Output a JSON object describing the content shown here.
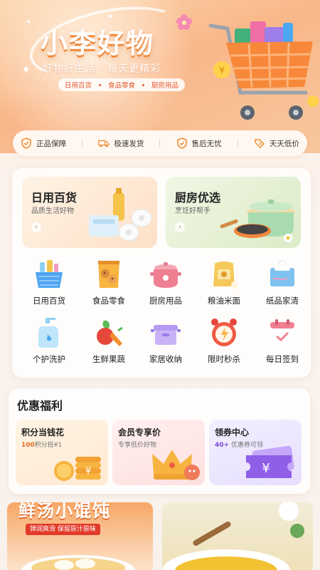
{
  "hero": {
    "brand": "小李好物",
    "slogan": "好物好生活 · 每天更精彩",
    "tags": [
      "日用百货",
      "食品零食",
      "厨房用品"
    ]
  },
  "guarantees": [
    {
      "icon": "shield-check-icon",
      "label": "正品保障"
    },
    {
      "icon": "truck-icon",
      "label": "极速发货"
    },
    {
      "icon": "service-shield-icon",
      "label": "售后无忧"
    },
    {
      "icon": "price-tag-icon",
      "label": "天天低价"
    }
  ],
  "feature_cards": [
    {
      "title": "日用百货",
      "subtitle": "品质生活好物"
    },
    {
      "title": "厨房优选",
      "subtitle": "烹饪好帮手"
    }
  ],
  "categories": [
    {
      "label": "日用百货",
      "icon": "basket-icon"
    },
    {
      "label": "食品零食",
      "icon": "snack-bag-icon"
    },
    {
      "label": "厨房用品",
      "icon": "cooking-pot-icon"
    },
    {
      "label": "粮油米面",
      "icon": "rice-sack-icon"
    },
    {
      "label": "纸品家清",
      "icon": "tissue-box-icon"
    },
    {
      "label": "个护洗护",
      "icon": "shampoo-bottle-icon"
    },
    {
      "label": "生鲜果蔬",
      "icon": "vegetables-icon"
    },
    {
      "label": "家居收纳",
      "icon": "storage-box-icon"
    },
    {
      "label": "限时秒杀",
      "icon": "alarm-clock-icon"
    },
    {
      "label": "每日签到",
      "icon": "calendar-check-icon"
    }
  ],
  "benefits": {
    "title": "优惠福利",
    "cards": [
      {
        "title": "积分当钱花",
        "highlight": "100",
        "subtitle": "积分抵¥1"
      },
      {
        "title": "会员专享价",
        "highlight": "",
        "subtitle": "专享低价好物"
      },
      {
        "title": "领券中心",
        "highlight": "40+",
        "subtitle": "优惠券可领"
      }
    ]
  },
  "banners": [
    {
      "title": "鲜汤小馄饨",
      "subtitle": "弹润爽滑 保留原汁原味"
    },
    {
      "title": "",
      "subtitle": ""
    }
  ],
  "colors": {
    "accent": "#f07a2c",
    "brand_text": "#ffffff",
    "price_orange": "#e56a20",
    "coupon_purple": "#7a4bd6"
  }
}
